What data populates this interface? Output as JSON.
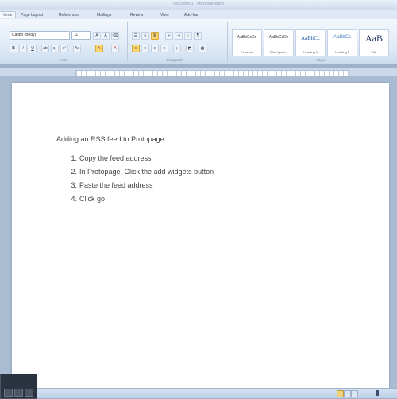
{
  "window": {
    "title": "Document1 - Microsoft Word"
  },
  "ribbon_tabs": [
    {
      "label": "Home"
    },
    {
      "label": "Page Layout"
    },
    {
      "label": "References"
    },
    {
      "label": "Mailings"
    },
    {
      "label": "Review"
    },
    {
      "label": "View"
    },
    {
      "label": "Add-Ins"
    }
  ],
  "font": {
    "name": "Calibri (Body)",
    "size": "11",
    "group_label": "Font"
  },
  "paragraph": {
    "group_label": "Paragraph"
  },
  "styles": {
    "group_label": "Styles",
    "items": [
      {
        "sample": "AaBbCcDc",
        "name": "¶ Normal"
      },
      {
        "sample": "AaBbCcDc",
        "name": "¶ No Spaci..."
      },
      {
        "sample": "AaBbCc",
        "name": "Heading 1"
      },
      {
        "sample": "AaBbCc",
        "name": "Heading 2"
      },
      {
        "sample": "AaB",
        "name": "Title"
      }
    ]
  },
  "document": {
    "heading": "Adding an RSS feed to Protopage",
    "steps": [
      {
        "num": "1.",
        "text": "Copy the feed address"
      },
      {
        "num": "2.",
        "text": "In Protopage, Click the add widgets button"
      },
      {
        "num": "3.",
        "text": "Paste the feed address"
      },
      {
        "num": "4.",
        "text": "Click go"
      }
    ]
  },
  "colors": {
    "ribbon_bg": "#dde8f5",
    "page_bg": "#ffffff",
    "workspace_bg": "#a9bcd2",
    "highlight": "#fbd56b"
  }
}
